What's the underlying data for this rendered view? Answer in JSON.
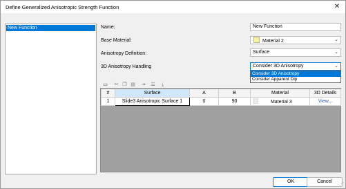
{
  "window": {
    "title": "Define Generalized Anisotropic Strength Function",
    "close_glyph": "✕"
  },
  "left_list": {
    "items": [
      "New Function"
    ]
  },
  "form": {
    "name_label": "Name:",
    "name_value": "New Function",
    "base_material_label": "Base Material:",
    "base_material_value": "Material 2",
    "base_material_color": "#f2f2a0",
    "anisotropy_definition_label": "Anisotropy Definition:",
    "anisotropy_definition_value": "Surface",
    "handling_label": "3D Anisotropy Handling",
    "handling_value": "Consider 3D Anisotropy",
    "handling_options": [
      "Consider 3D Anisotropy",
      "Consider Apparent Dip"
    ],
    "handling_selected_option": "Consider 3D Anisotropy"
  },
  "toolbar": {
    "icons": [
      "new-row-icon",
      "cut-icon",
      "copy-icon",
      "paste-icon",
      "insert-row-icon",
      "delete-row-icon",
      "fill-down-icon"
    ]
  },
  "grid": {
    "columns": [
      "#",
      "Surface",
      "A",
      "B",
      "Material",
      "3D Details"
    ],
    "rows": [
      {
        "num": "1",
        "surface": "Slide3 Anisotropic Surface 1",
        "a": "0",
        "b": "90",
        "material": "Material 3",
        "details": "View..."
      }
    ]
  },
  "buttons": {
    "ok": "OK",
    "cancel": "Cancel"
  },
  "colors": {
    "accent": "#0078d7",
    "grid_background": "#a0a0a0"
  }
}
